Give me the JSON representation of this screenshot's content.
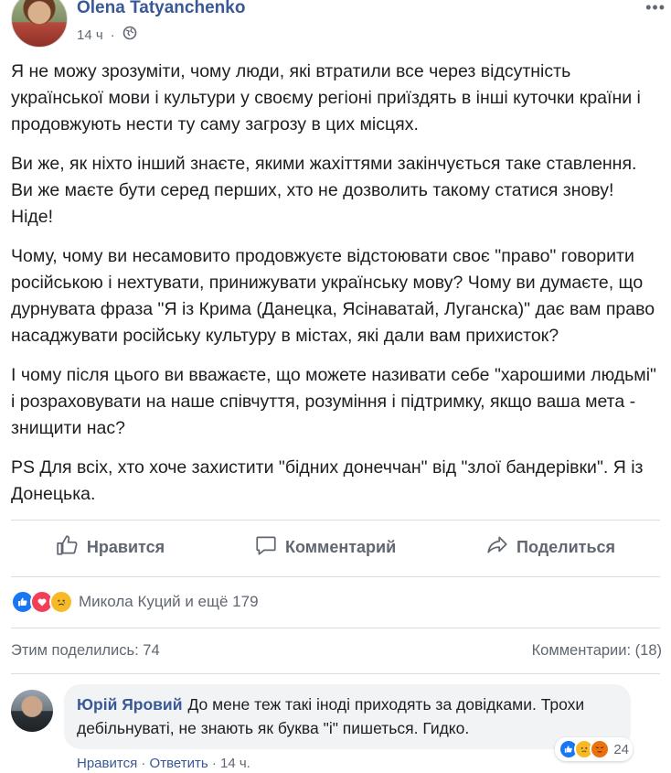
{
  "post": {
    "author": "Olena Tatyanchenko",
    "time": "14 ч",
    "paragraphs": [
      "Я не можу зрозуміти, чому люди, які втратили все через відсутність української мови і культури у своєму регіоні приїздять в інші куточки країни і продовжують нести ту саму загрозу в цих місцях.",
      "Ви же, як ніхто інший знаєте, якими жахіттями закінчується таке ставлення. Ви же маєте бути серед перших, хто не дозволить такому статися знову! Ніде!",
      "Чому, чому ви несамовито продовжуєте відстоювати своє \"право\" говорити російською і нехтувати, принижувати українську мову? Чому ви думаєте, що дурнувата фраза \"Я із Крима (Данецка, Ясінаватай, Луганска)\" дає вам право насаджувати російську культуру в містах, які дали вам прихисток?",
      "І чому після цього ви вважаєте, що можете називати себе \"харошими людьмі\" і розраховувати на наше співчуття, розуміння і підтримку, якщо ваша мета - знищити нас?",
      "PS Для всіх, хто хоче захистити \"бідних донеччан\" від \"злої бандерівки\". Я із Донецька."
    ]
  },
  "actions": {
    "like": "Нравится",
    "comment": "Комментарий",
    "share": "Поделиться"
  },
  "reactions": {
    "summary": "Микола Куций и ещё 179"
  },
  "stats": {
    "shares": "Этим поделились: 74",
    "comments": "Комментарии: (18)"
  },
  "comment": {
    "author": "Юрій Яровий",
    "text": "До мене теж такі іноді приходять за довідками. Трохи дебільнуваті, не знають як буква \"і\" пишеться. Гидко.",
    "reaction_count": "24",
    "like": "Нравится",
    "reply": "Ответить",
    "time": "14 ч."
  },
  "colors": {
    "link": "#385898",
    "like_blue": "#1877f2",
    "love_red": "#f33e58",
    "haha_yellow": "#f7b928"
  }
}
